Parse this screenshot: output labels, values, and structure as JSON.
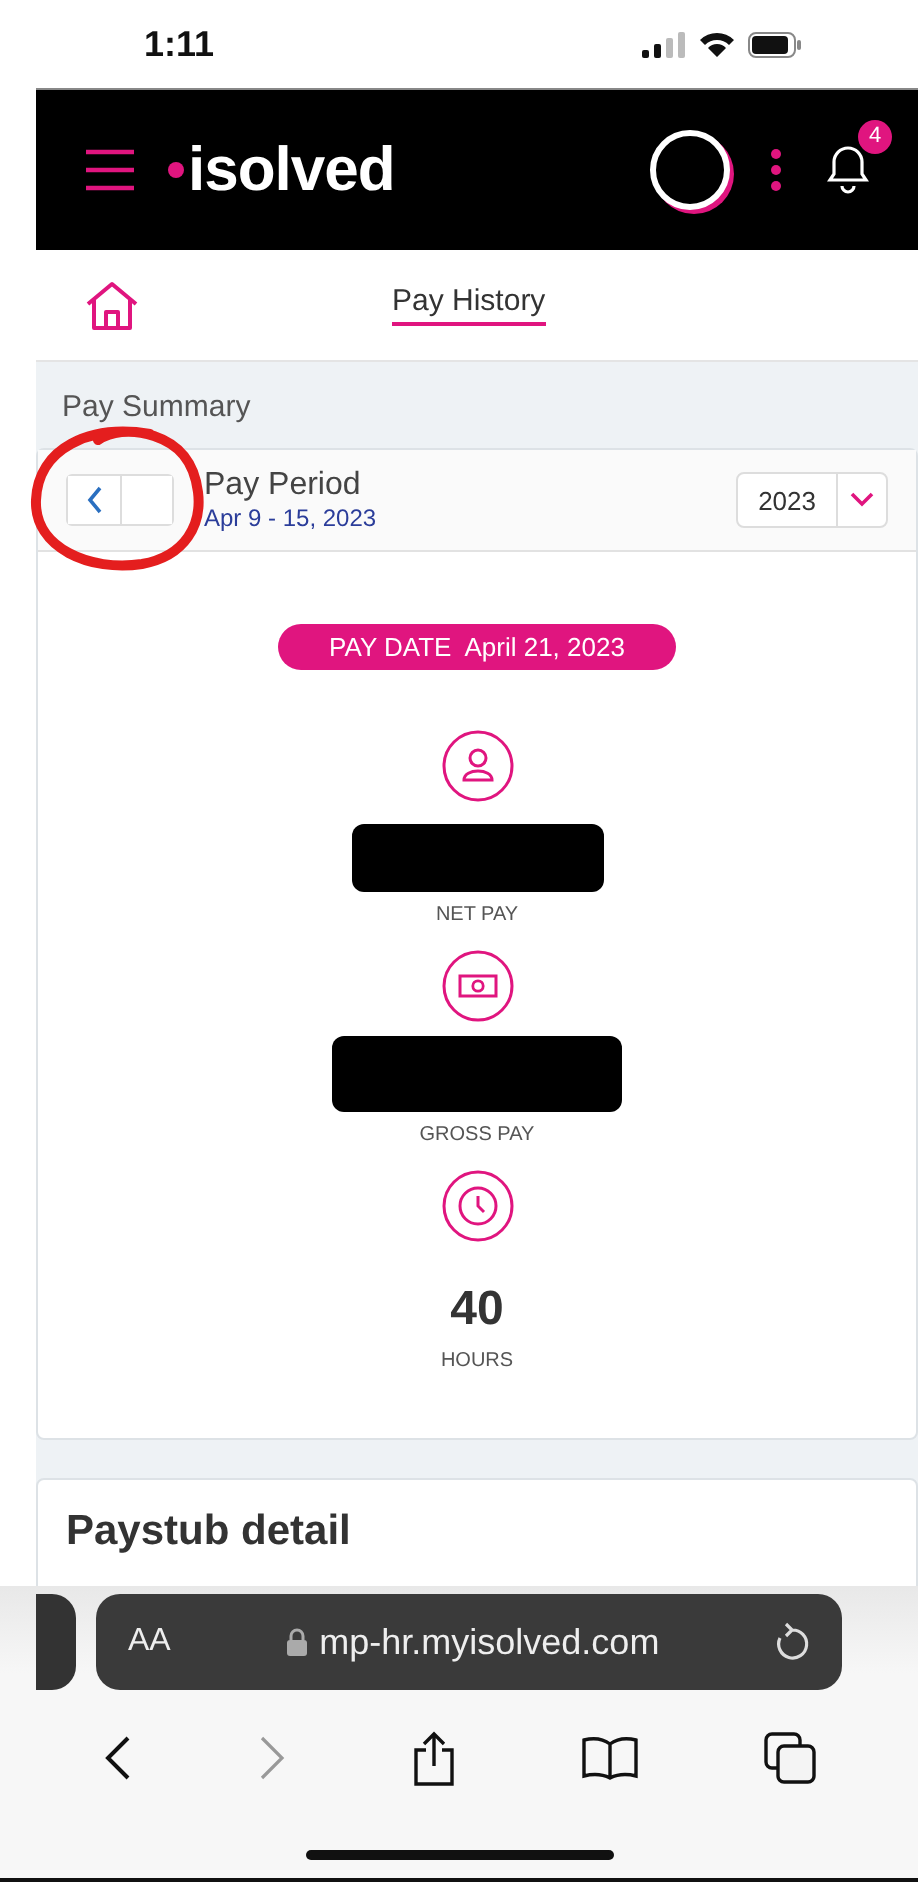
{
  "status_bar": {
    "time": "1:11"
  },
  "header": {
    "logo": "isolved",
    "notification_count": "4"
  },
  "nav": {
    "title": "Pay History"
  },
  "pay_summary": {
    "title": "Pay Summary",
    "period_label": "Pay Period",
    "period_range": "Apr 9 - 15, 2023",
    "year": "2023",
    "pay_date_label": "PAY DATE",
    "pay_date": "April 21, 2023",
    "metrics": [
      {
        "kind": "person",
        "redacted": true,
        "label": "NET PAY"
      },
      {
        "kind": "money",
        "redacted": true,
        "label": "GROSS PAY"
      },
      {
        "kind": "clock",
        "redacted": false,
        "value": "40",
        "label": "HOURS"
      }
    ]
  },
  "paystub": {
    "title": "Paystub detail"
  },
  "browser": {
    "text_size": "AA",
    "url": "mp-hr.myisolved.com"
  }
}
